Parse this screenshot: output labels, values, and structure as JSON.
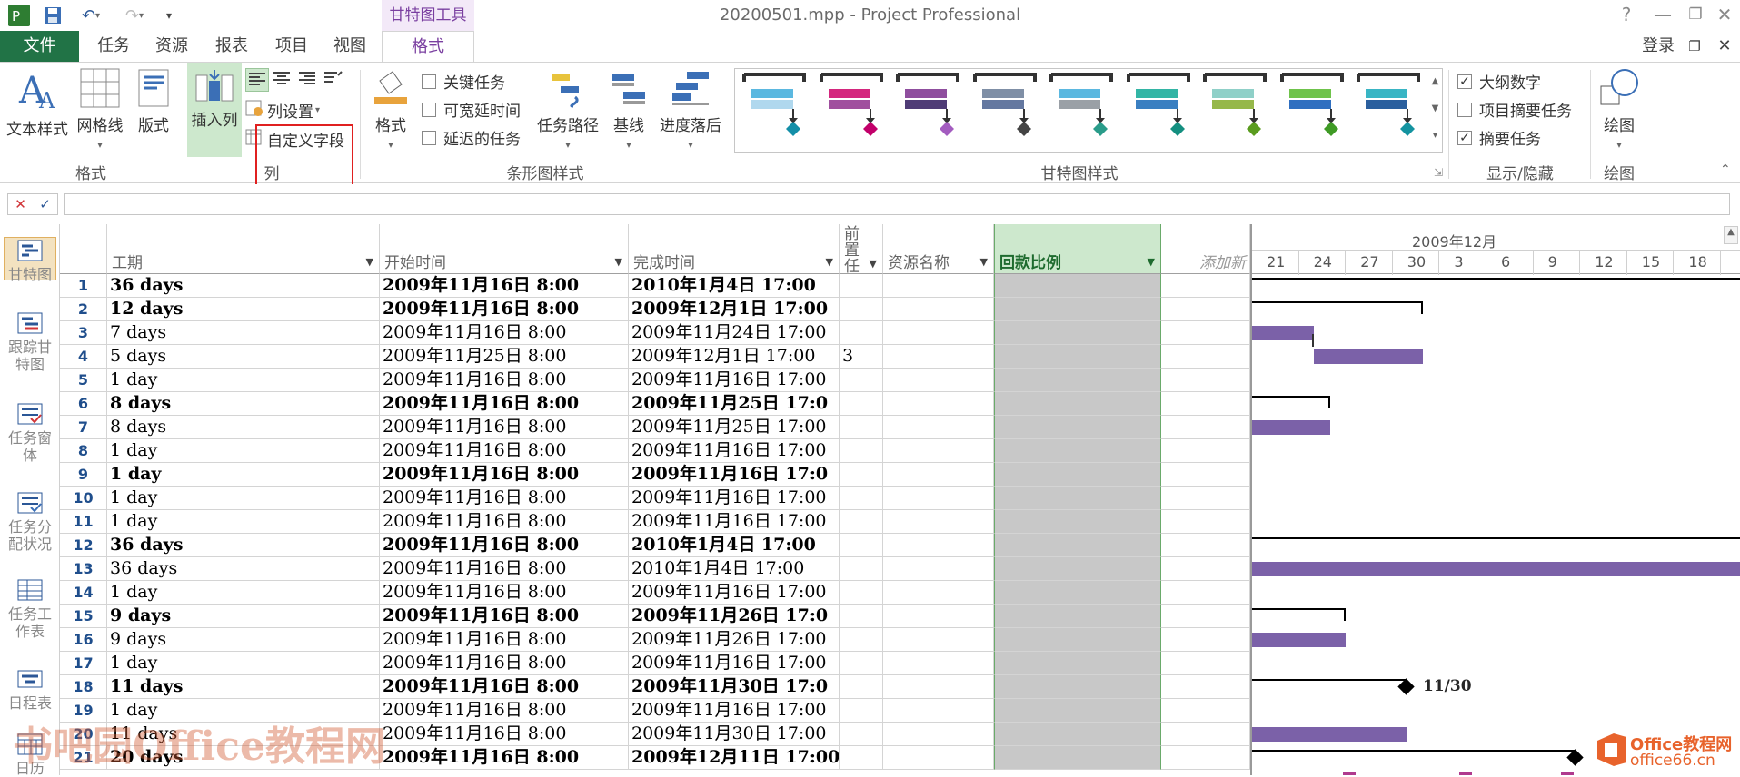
{
  "app": {
    "title": "20200501.mpp - Project Professional",
    "context_group": "甘特图工具",
    "login": "登录"
  },
  "tabs": [
    "文件",
    "任务",
    "资源",
    "报表",
    "项目",
    "视图",
    "格式"
  ],
  "ribbon": {
    "format_group": {
      "label": "格式",
      "text_styles": "文本样式",
      "gridlines": "网格线",
      "layout": "版式"
    },
    "columns_group": {
      "label": "列",
      "insert_column": "插入列",
      "column_settings": "列设置",
      "custom_fields": "自定义字段"
    },
    "bar_styles_group": {
      "label": "条形图样式",
      "format": "格式",
      "critical": "关键任务",
      "slack": "可宽延时间",
      "late": "延迟的任务",
      "task_path": "任务路径",
      "baseline": "基线",
      "slippage": "进度落后"
    },
    "gantt_styles_group": {
      "label": "甘特图样式"
    },
    "show_hide_group": {
      "label": "显示/隐藏",
      "outline_numbers": "大纲数字",
      "project_summary": "项目摘要任务",
      "summary_tasks": "摘要任务"
    },
    "drawing_group": {
      "label": "绘图",
      "drawing": "绘图"
    }
  },
  "gantt_style_colors": [
    [
      "#5bb8e0",
      "#b0d8ee",
      "#148fa8"
    ],
    [
      "#d4277e",
      "#a04f9e",
      "#c2006a"
    ],
    [
      "#8f4e9e",
      "#4f3c76",
      "#a35cbf"
    ],
    [
      "#7f8fa6",
      "#6478a0",
      "#444"
    ],
    [
      "#5bb8e0",
      "#9aa0a6",
      "#2a9c8a"
    ],
    [
      "#33b5a5",
      "#3a7fc1",
      "#148f80"
    ],
    [
      "#8fd0c8",
      "#96b84a",
      "#5a9c1f"
    ],
    [
      "#6fc34b",
      "#2f6fc0",
      "#3f9a25"
    ],
    [
      "#39b5c4",
      "#2a5f9e",
      "#1493a0"
    ]
  ],
  "sidebar": [
    "甘特图",
    "跟踪甘特图",
    "任务窗体",
    "任务分配状况",
    "任务工作表",
    "日程表",
    "日历"
  ],
  "columns": {
    "duration": "工期",
    "start": "开始时间",
    "finish": "完成时间",
    "predecessors": "前置任",
    "resource": "资源名称",
    "payment": "回款比例",
    "add": "添加新"
  },
  "rows": [
    {
      "id": "1",
      "dur": "36 days",
      "start": "2009年11月16日 8:00",
      "finish": "2010年1月4日 17:00",
      "pred": "",
      "bold": true
    },
    {
      "id": "2",
      "dur": "12 days",
      "start": "2009年11月16日 8:00",
      "finish": "2009年12月1日 17:00",
      "pred": "",
      "bold": true
    },
    {
      "id": "3",
      "dur": "7 days",
      "start": "2009年11月16日 8:00",
      "finish": "2009年11月24日 17:00",
      "pred": "",
      "bold": false
    },
    {
      "id": "4",
      "dur": "5 days",
      "start": "2009年11月25日 8:00",
      "finish": "2009年12月1日 17:00",
      "pred": "3",
      "bold": false
    },
    {
      "id": "5",
      "dur": "1 day",
      "start": "2009年11月16日 8:00",
      "finish": "2009年11月16日 17:00",
      "pred": "",
      "bold": false
    },
    {
      "id": "6",
      "dur": "8 days",
      "start": "2009年11月16日 8:00",
      "finish": "2009年11月25日 17:0",
      "pred": "",
      "bold": true
    },
    {
      "id": "7",
      "dur": "8 days",
      "start": "2009年11月16日 8:00",
      "finish": "2009年11月25日 17:00",
      "pred": "",
      "bold": false
    },
    {
      "id": "8",
      "dur": "1 day",
      "start": "2009年11月16日 8:00",
      "finish": "2009年11月16日 17:00",
      "pred": "",
      "bold": false
    },
    {
      "id": "9",
      "dur": "1 day",
      "start": "2009年11月16日 8:00",
      "finish": "2009年11月16日 17:0",
      "pred": "",
      "bold": true
    },
    {
      "id": "10",
      "dur": "1 day",
      "start": "2009年11月16日 8:00",
      "finish": "2009年11月16日 17:00",
      "pred": "",
      "bold": false
    },
    {
      "id": "11",
      "dur": "1 day",
      "start": "2009年11月16日 8:00",
      "finish": "2009年11月16日 17:00",
      "pred": "",
      "bold": false
    },
    {
      "id": "12",
      "dur": "36 days",
      "start": "2009年11月16日 8:00",
      "finish": "2010年1月4日 17:00",
      "pred": "",
      "bold": true
    },
    {
      "id": "13",
      "dur": "36 days",
      "start": "2009年11月16日 8:00",
      "finish": "2010年1月4日 17:00",
      "pred": "",
      "bold": false
    },
    {
      "id": "14",
      "dur": "1 day",
      "start": "2009年11月16日 8:00",
      "finish": "2009年11月16日 17:00",
      "pred": "",
      "bold": false
    },
    {
      "id": "15",
      "dur": "9 days",
      "start": "2009年11月16日 8:00",
      "finish": "2009年11月26日 17:0",
      "pred": "",
      "bold": true
    },
    {
      "id": "16",
      "dur": "9 days",
      "start": "2009年11月16日 8:00",
      "finish": "2009年11月26日 17:00",
      "pred": "",
      "bold": false
    },
    {
      "id": "17",
      "dur": "1 day",
      "start": "2009年11月16日 8:00",
      "finish": "2009年11月16日 17:00",
      "pred": "",
      "bold": false
    },
    {
      "id": "18",
      "dur": "11 days",
      "start": "2009年11月16日 8:00",
      "finish": "2009年11月30日 17:0",
      "pred": "",
      "bold": true
    },
    {
      "id": "19",
      "dur": "1 day",
      "start": "2009年11月16日 8:00",
      "finish": "2009年11月16日 17:00",
      "pred": "",
      "bold": false
    },
    {
      "id": "20",
      "dur": "11 days",
      "start": "2009年11月16日 8:00",
      "finish": "2009年11月30日 17:00",
      "pred": "",
      "bold": false
    },
    {
      "id": "21",
      "dur": "20 days",
      "start": "2009年11月16日 8:00",
      "finish": "2009年12月11日 17:00",
      "pred": "",
      "bold": true
    }
  ],
  "timescale": {
    "month": "2009年12月",
    "days": [
      "21",
      "24",
      "27",
      "30",
      "3",
      "6",
      "9",
      "12",
      "15",
      "18"
    ]
  },
  "milestone_label": "11/30",
  "watermark": {
    "left": "书吧园Office教程网",
    "logo_top": "Office教程网",
    "logo_bottom": "office66.cn"
  }
}
